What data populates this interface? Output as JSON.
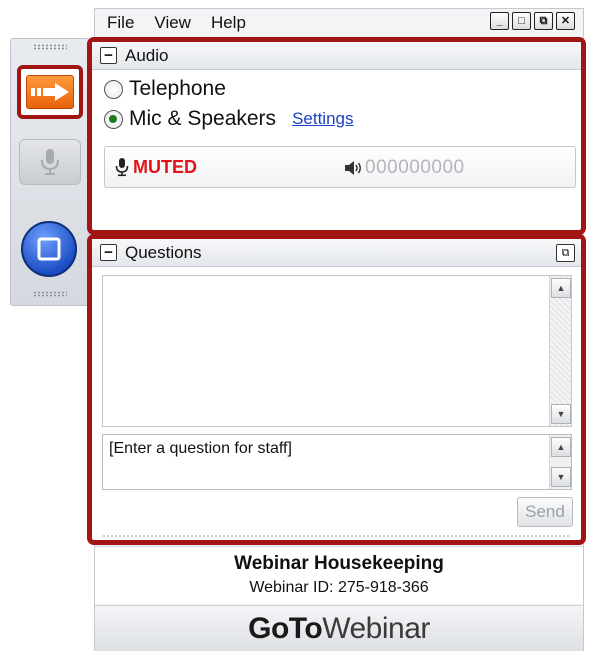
{
  "menu": {
    "items": [
      "File",
      "View",
      "Help"
    ]
  },
  "window_controls": {
    "minimize": "_",
    "restore": "□",
    "popout": "⧉",
    "close": "✕"
  },
  "audio": {
    "title": "Audio",
    "options": [
      {
        "label": "Telephone",
        "selected": false
      },
      {
        "label": "Mic & Speakers",
        "selected": true
      }
    ],
    "settings_link": "Settings",
    "status": "MUTED",
    "level_dots": "000000000"
  },
  "questions": {
    "title": "Questions",
    "placeholder": "[Enter a question for staff]",
    "send_label": "Send"
  },
  "footer": {
    "title": "Webinar Housekeeping",
    "webinar_id": "Webinar ID: 275-918-366",
    "brand_bold": "GoTo",
    "brand_regular": "Webinar"
  },
  "colors": {
    "highlight_outline": "#a31515",
    "muted_red": "#e0141a",
    "link_blue": "#1b3fc7",
    "arrow_orange": "#e8620a",
    "screen_blue": "#1d4fc4"
  },
  "icons": {
    "show_hide_panel": "orange-arrow-icon",
    "microphone": "microphone-icon",
    "screen_share": "screen-share-icon",
    "muted_mic": "mic-muted-icon",
    "speaker": "speaker-icon"
  }
}
